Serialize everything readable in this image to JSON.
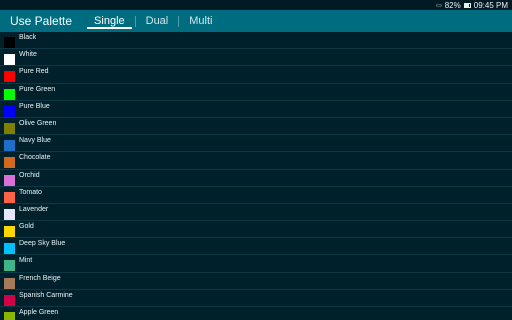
{
  "status": {
    "battery": "82%",
    "time": "09:45 PM",
    "wifi_icon": "wifi-icon"
  },
  "header": {
    "title": "Use Palette",
    "tabs": [
      {
        "label": "Single",
        "active": true
      },
      {
        "label": "Dual",
        "active": false
      },
      {
        "label": "Multi",
        "active": false
      }
    ]
  },
  "colors": [
    {
      "name": "Black",
      "color": "#000000"
    },
    {
      "name": "White",
      "color": "#ffffff"
    },
    {
      "name": "Pure Red",
      "color": "#ff0000"
    },
    {
      "name": "Pure Green",
      "color": "#00ff00"
    },
    {
      "name": "Pure Blue",
      "color": "#0000ff"
    },
    {
      "name": "Olive Green",
      "color": "#808000"
    },
    {
      "name": "Navy Blue",
      "color": "#1f6fc8"
    },
    {
      "name": "Chocolate",
      "color": "#d2691e"
    },
    {
      "name": "Orchid",
      "color": "#da70d6"
    },
    {
      "name": "Tomato",
      "color": "#ff6347"
    },
    {
      "name": "Lavender",
      "color": "#e6e6fa"
    },
    {
      "name": "Gold",
      "color": "#ffd700"
    },
    {
      "name": "Deep Sky Blue",
      "color": "#00bfff"
    },
    {
      "name": "Mint",
      "color": "#3eb489"
    },
    {
      "name": "French Beige",
      "color": "#a67b5b"
    },
    {
      "name": "Spanish Carmine",
      "color": "#d10047"
    },
    {
      "name": "Apple Green",
      "color": "#8db600"
    }
  ]
}
